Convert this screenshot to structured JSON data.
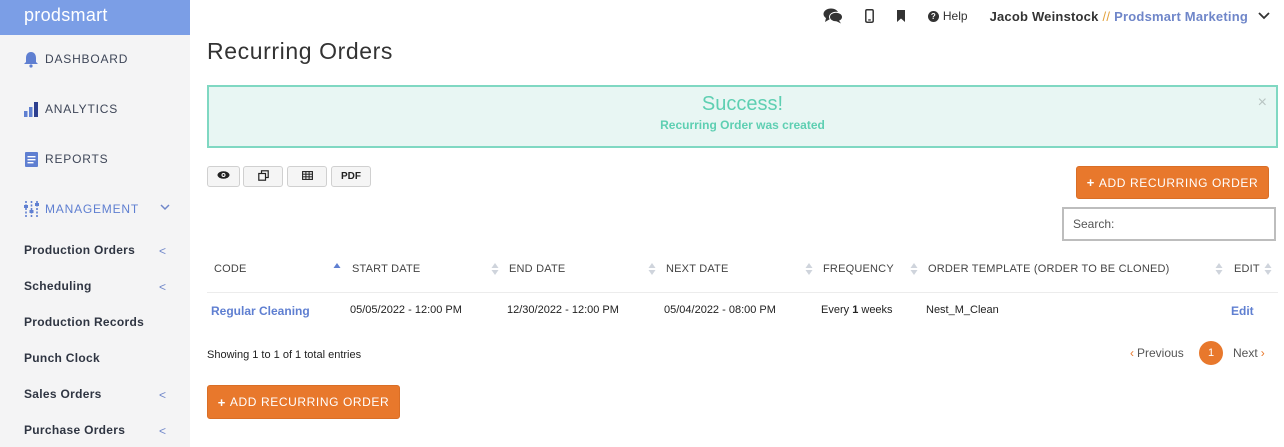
{
  "brand": "prodsmart",
  "sidebar": {
    "top_items": [
      {
        "label": "DASHBOARD",
        "icon": "bell-icon"
      },
      {
        "label": "ANALYTICS",
        "icon": "bar-chart-icon"
      },
      {
        "label": "REPORTS",
        "icon": "document-icon"
      },
      {
        "label": "MANAGEMENT",
        "icon": "sliders-icon"
      }
    ],
    "sub_items": [
      {
        "label": "Production Orders"
      },
      {
        "label": "Scheduling"
      },
      {
        "label": "Production Records"
      },
      {
        "label": "Punch Clock"
      },
      {
        "label": "Sales Orders"
      },
      {
        "label": "Purchase Orders"
      }
    ],
    "chevron_glyph": "<"
  },
  "topbar": {
    "help": "Help",
    "user_name": "Jacob Weinstock",
    "separator": "//",
    "org": "Prodsmart Marketing"
  },
  "page": {
    "title": "Recurring Orders"
  },
  "alert": {
    "title": "Success!",
    "message": "Recurring Order was created",
    "close": "×"
  },
  "toolbar": {
    "pdf": "PDF"
  },
  "add_button": "ADD RECURRING ORDER",
  "search": {
    "placeholder": "Search:"
  },
  "table": {
    "headers": [
      "CODE",
      "START DATE",
      "END DATE",
      "NEXT DATE",
      "FREQUENCY",
      "ORDER TEMPLATE (ORDER TO BE CLONED)",
      "EDIT"
    ],
    "rows": [
      {
        "code": "Regular Cleaning",
        "start": "05/05/2022 - 12:00 PM",
        "end": "12/30/2022 - 12:00 PM",
        "next": "05/04/2022 - 08:00 PM",
        "freq_pre": "Every",
        "freq_num": "1",
        "freq_post": "weeks",
        "template": "Nest_M_Clean",
        "edit": "Edit"
      }
    ]
  },
  "info": "Showing 1 to 1 of 1 total entries",
  "pagination": {
    "previous": "Previous",
    "page": "1",
    "next": "Next",
    "prev_glyph": "‹",
    "next_glyph": "›"
  },
  "colors": {
    "accent": "#e8782c",
    "brand": "#7b9ee6",
    "link": "#5f7fd1",
    "success": "#5ecfb2"
  }
}
